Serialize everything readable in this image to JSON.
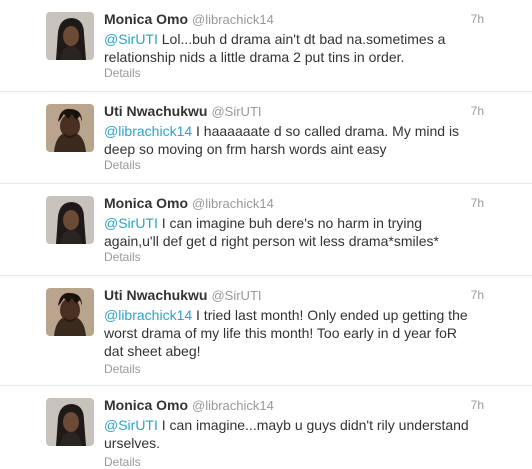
{
  "tweets": [
    {
      "name": "Monica Omo",
      "handle": "@librachick14",
      "time": "7h",
      "mention": "@SirUTI",
      "text": " Lol...buh d drama ain't dt bad na.sometimes a relationship nids a little drama 2 put tins in order.",
      "details": "Details",
      "avatar": "woman-avatar"
    },
    {
      "name": "Uti Nwachukwu",
      "handle": "@SirUTI",
      "time": "7h",
      "mention": "@librachick14",
      "text": " I haaaaaate d so called drama. My mind is deep so moving on frm harsh words aint easy",
      "details": "Details",
      "avatar": "man-avatar"
    },
    {
      "name": "Monica Omo",
      "handle": "@librachick14",
      "time": "7h",
      "mention": "@SirUTI",
      "text": " I can imagine buh dere's no harm in trying again,u'll def get d right person wit less drama*smiles*",
      "details": "Details",
      "avatar": "woman-avatar"
    },
    {
      "name": "Uti Nwachukwu",
      "handle": "@SirUTI",
      "time": "7h",
      "mention": "@librachick14",
      "text": " I tried last month! Only ended up getting the worst drama of my life this month! Too early in d year foR dat sheet abeg!",
      "details": "Details",
      "avatar": "man-avatar"
    },
    {
      "name": "Monica Omo",
      "handle": "@librachick14",
      "time": "7h",
      "mention": "@SirUTI",
      "text": " I can imagine...mayb u guys didn't rily understand urselves.",
      "details": "Details",
      "avatar": "woman-avatar"
    }
  ],
  "colors": {
    "mention": "#2fa3c6",
    "meta": "#999999",
    "text": "#333333",
    "divider": "#e8e8e8"
  }
}
